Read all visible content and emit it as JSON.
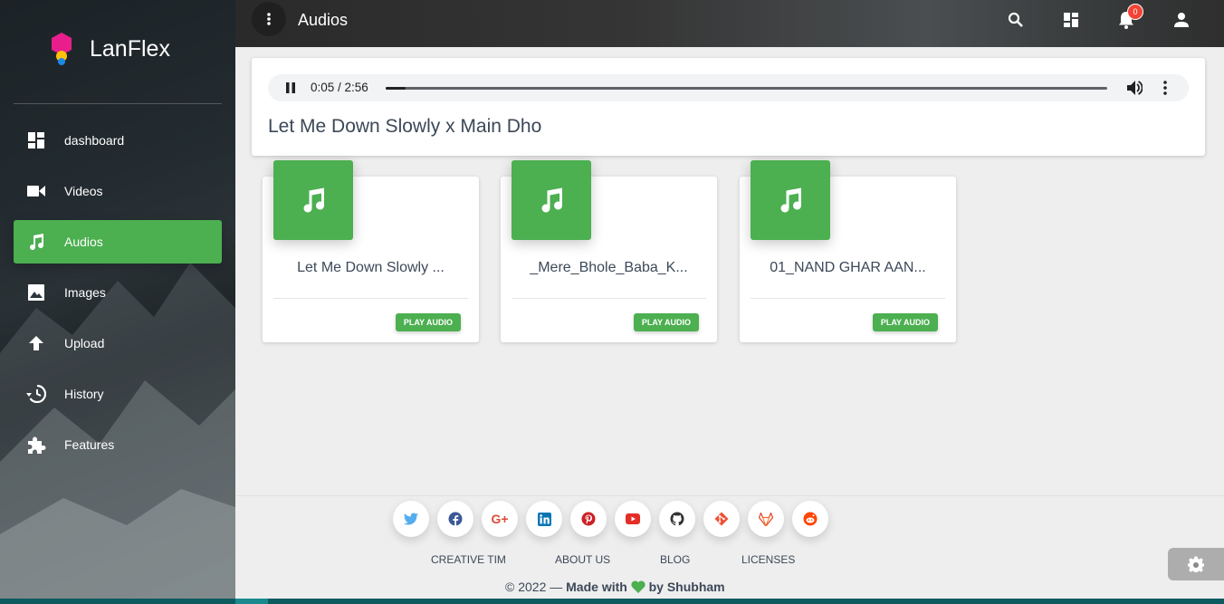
{
  "brand": {
    "name": "LanFlex"
  },
  "sidebar": {
    "items": [
      {
        "label": "dashboard",
        "icon": "dashboard-icon"
      },
      {
        "label": "Videos",
        "icon": "videocam-icon"
      },
      {
        "label": "Audios",
        "icon": "music-note-icon",
        "active": true
      },
      {
        "label": "Images",
        "icon": "image-icon"
      },
      {
        "label": "Upload",
        "icon": "arrow-up-icon"
      },
      {
        "label": "History",
        "icon": "history-icon"
      },
      {
        "label": "Features",
        "icon": "puzzle-icon"
      }
    ]
  },
  "topbar": {
    "title": "Audios",
    "notification_count": "0",
    "icons": [
      "search-icon",
      "apps-grid-icon",
      "bell-icon",
      "person-icon"
    ]
  },
  "player": {
    "time": "0:05 / 2:56",
    "progress": 0.028,
    "now_playing": "Let Me Down Slowly x Main Dho"
  },
  "audio_cards": [
    {
      "title": "Let Me Down Slowly ...",
      "button": "PLAY AUDIO"
    },
    {
      "title": "_Mere_Bhole_Baba_K...",
      "button": "PLAY AUDIO"
    },
    {
      "title": "01_NAND GHAR AAN...",
      "button": "PLAY AUDIO"
    }
  ],
  "footer": {
    "social_icons": [
      "twitter-icon",
      "facebook-icon",
      "google-plus-icon",
      "linkedin-icon",
      "pinterest-icon",
      "youtube-icon",
      "github-icon",
      "git-icon",
      "gitlab-icon",
      "reddit-icon"
    ],
    "social_glyphs": [
      "G+"
    ],
    "links": [
      "CREATIVE TIM",
      "ABOUT US",
      "BLOG",
      "LICENSES"
    ],
    "copyright_prefix": "© 2022 — ",
    "made_with": "Made with",
    "by": "by Shubham"
  },
  "colors": {
    "accent": "#4caf50",
    "badge": "#f44336",
    "sidebar_bg": "#2c363b"
  }
}
